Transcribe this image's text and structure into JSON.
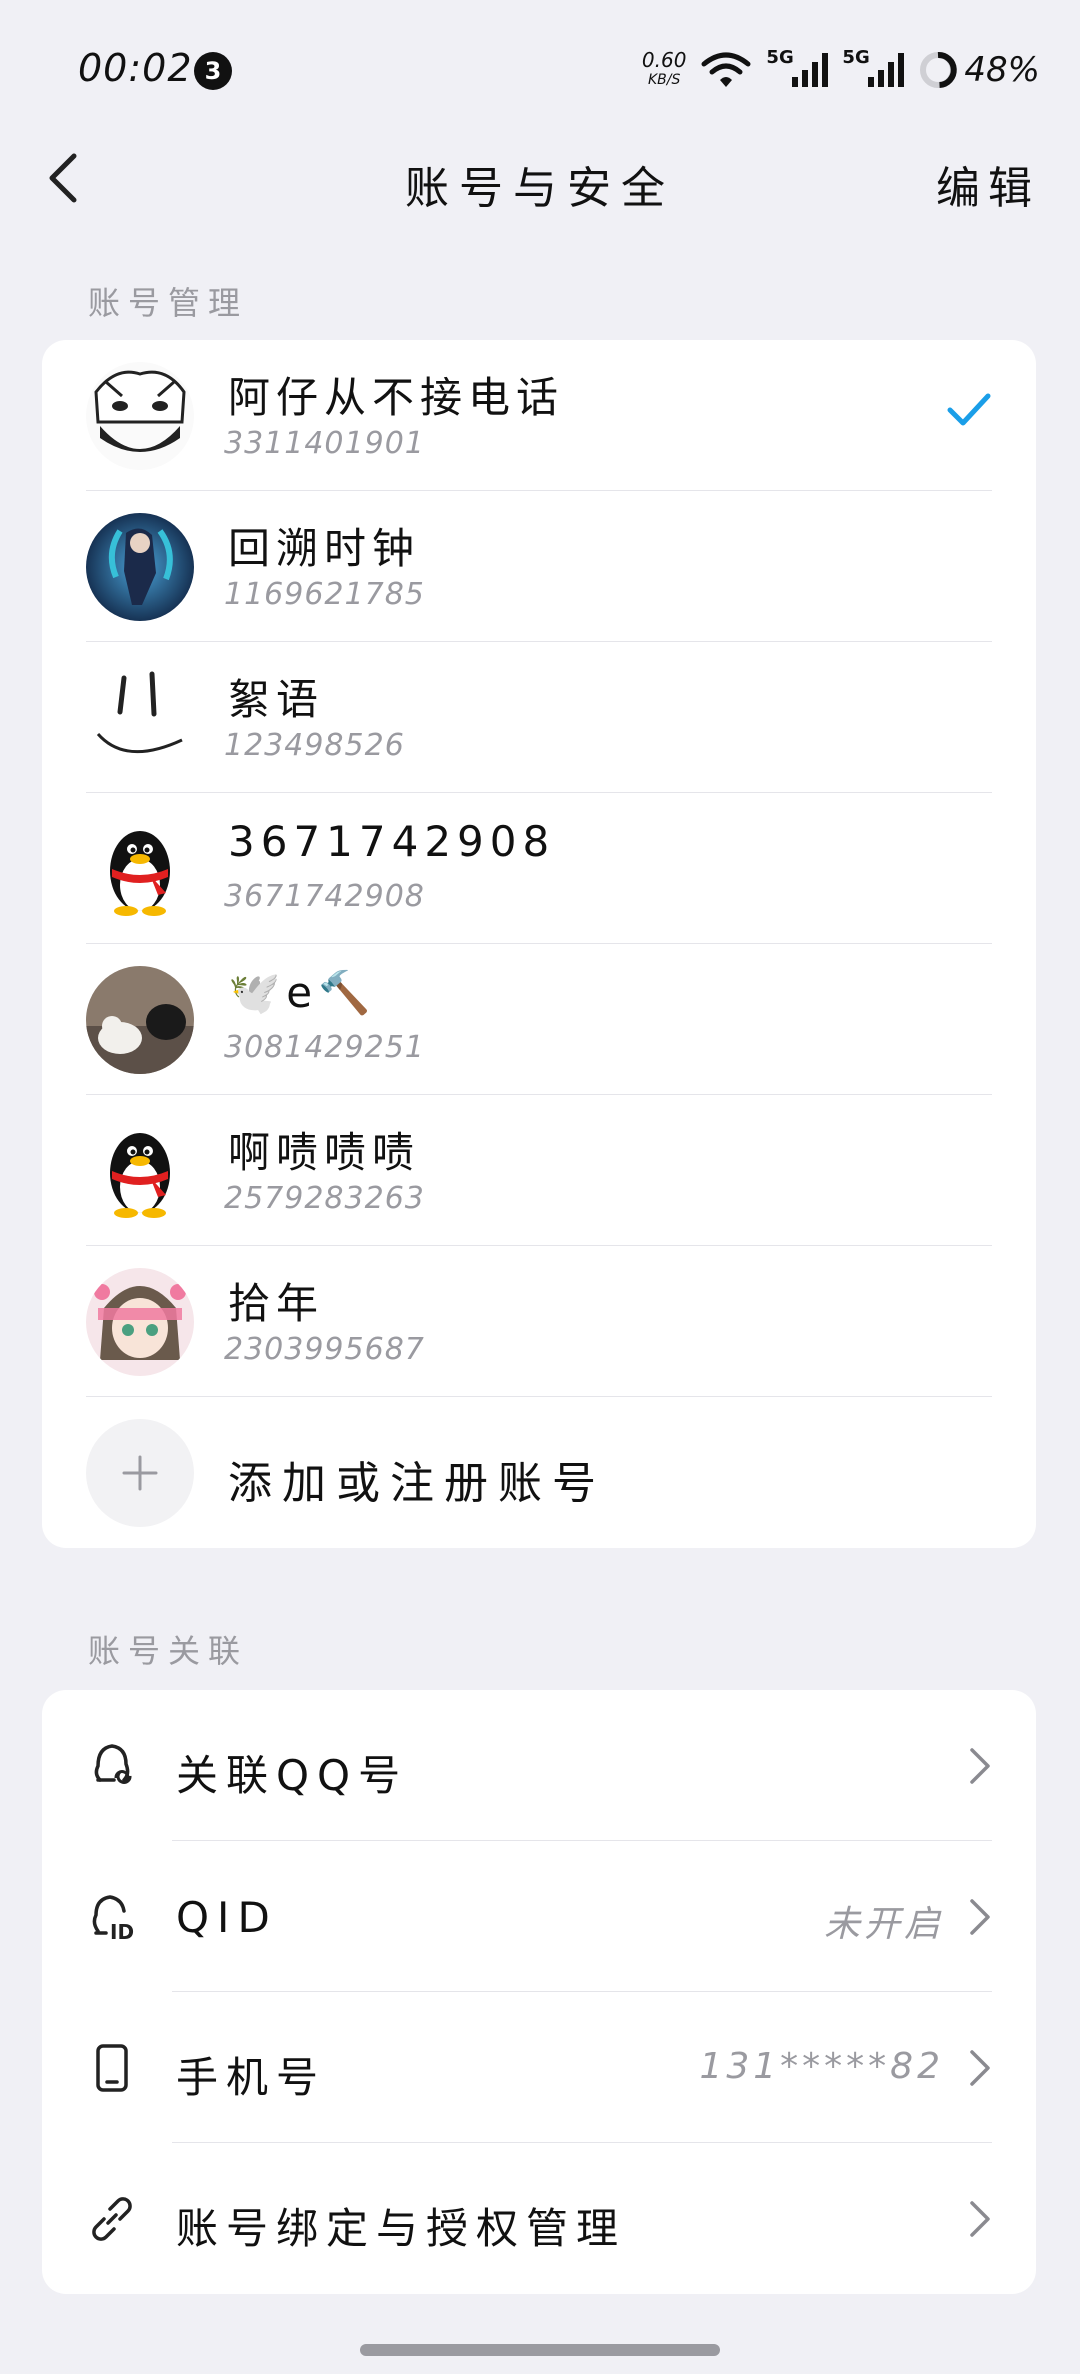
{
  "status_bar": {
    "time": "00:02",
    "notification_count": "3",
    "net_speed": "0.60",
    "net_speed_unit": "KB/S",
    "signal1": "5G",
    "signal2": "5G",
    "battery": "48%"
  },
  "header": {
    "title": "账号与安全",
    "edit_label": "编辑"
  },
  "accounts_section": {
    "title": "账号管理",
    "accounts": [
      {
        "name": "阿仔从不接电话",
        "number": "3311401901",
        "selected": true
      },
      {
        "name": "回溯时钟",
        "number": "1169621785"
      },
      {
        "name": "絮语",
        "number": "123498526"
      },
      {
        "name": "3671742908",
        "number": "3671742908"
      },
      {
        "name": "🕊️e🔨",
        "number": "3081429251"
      },
      {
        "name": "啊啧啧啧",
        "number": "2579283263"
      },
      {
        "name": "拾年",
        "number": "2303995687"
      }
    ],
    "add_label": "添加或注册账号"
  },
  "link_section": {
    "title": "账号关联",
    "items": [
      {
        "label": "关联QQ号",
        "value": "",
        "icon": "qq-link-icon"
      },
      {
        "label": "QID",
        "value": "未开启",
        "icon": "qid-icon"
      },
      {
        "label": "手机号",
        "value": "131*****82",
        "icon": "phone-icon"
      },
      {
        "label": "账号绑定与授权管理",
        "value": "",
        "icon": "link-icon"
      }
    ]
  },
  "colors": {
    "accent": "#1a9ee8",
    "background": "#f0f0f5",
    "muted": "#9a9aa0"
  }
}
